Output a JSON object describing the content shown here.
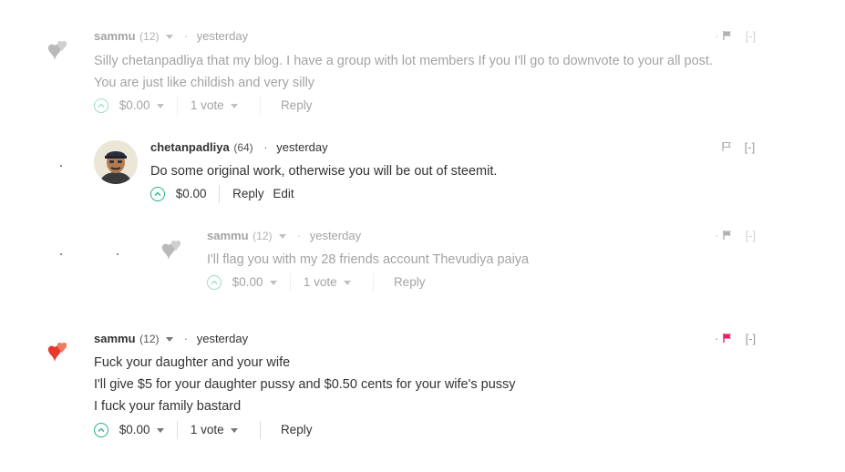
{
  "comments": [
    {
      "author": "sammu",
      "reputation": "(12)",
      "time": "yesterday",
      "body": [
        "Silly chetanpadliya that my blog. I have a group with lot members If you I'll go to downvote to your all post.",
        "You are just like childish and very silly"
      ],
      "payout": "$0.00",
      "votes": "1 vote",
      "reply": "Reply",
      "collapse": "[-]",
      "flag_color": "#555555"
    },
    {
      "author": "chetanpadliya",
      "reputation": "(64)",
      "time": "yesterday",
      "body": [
        "Do some original work, otherwise you will be out of steemit."
      ],
      "payout": "$0.00",
      "reply": "Reply",
      "edit": "Edit",
      "collapse": "[-]",
      "flag_color": "#bbbbbb"
    },
    {
      "author": "sammu",
      "reputation": "(12)",
      "time": "yesterday",
      "body": [
        "I'll flag you with my 28 friends account Thevudiya paiya"
      ],
      "payout": "$0.00",
      "votes": "1 vote",
      "reply": "Reply",
      "collapse": "[-]",
      "flag_color": "#555555"
    },
    {
      "author": "sammu",
      "reputation": "(12)",
      "time": "yesterday",
      "body": [
        "Fuck your daughter and your wife",
        "I'll give $5 for your daughter pussy and $0.50 cents for your wife's pussy",
        "I fuck your family bastard"
      ],
      "payout": "$0.00",
      "votes": "1 vote",
      "reply": "Reply",
      "collapse": "[-]",
      "flag_color": "#e91e63"
    }
  ],
  "colors": {
    "upvote": "#26b08a",
    "text": "#333333",
    "muted": "#777777"
  },
  "icons": {
    "avatar_placeholder": "hearts-icon",
    "flag": "flag-icon",
    "upvote": "chevron-up-circle-icon"
  }
}
